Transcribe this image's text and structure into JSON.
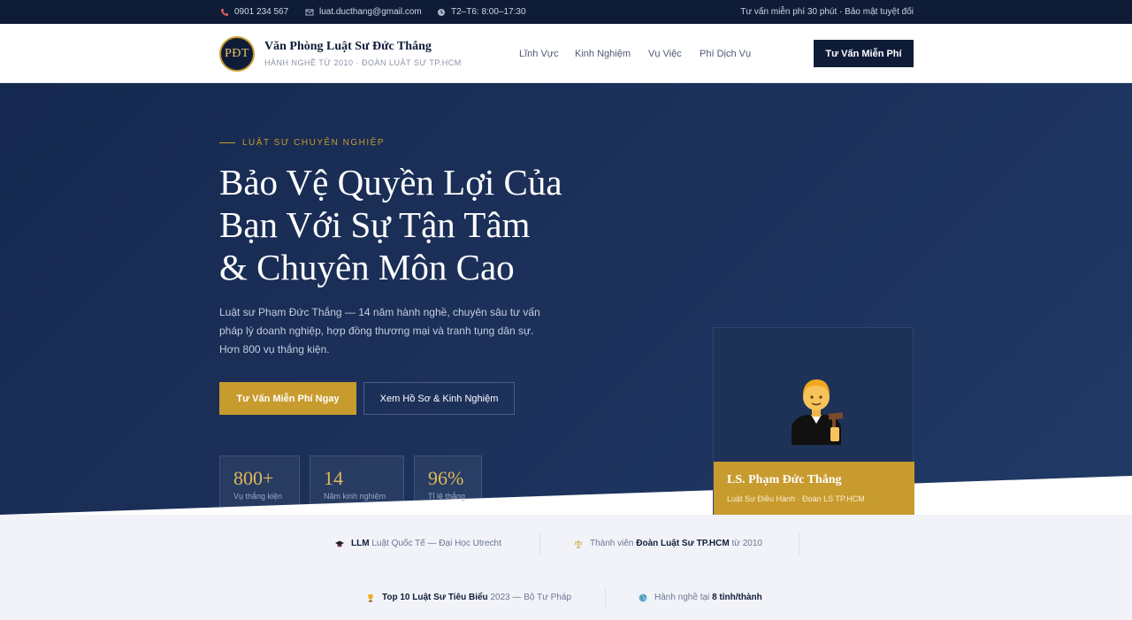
{
  "topbar": {
    "phone": "0901 234 567",
    "email": "luat.ducthang@gmail.com",
    "hours": "T2–T6: 8:00–17:30",
    "promo": "Tư vấn miễn phí 30 phút · Bảo mật tuyệt đối"
  },
  "header": {
    "logo_text": "PĐT",
    "brand_name": "Văn Phòng Luật Sư Đức Thắng",
    "brand_sub": "HÀNH NGHỀ TỪ 2010 · ĐOÀN LUẬT SƯ TP.HCM",
    "nav": [
      "Lĩnh Vực",
      "Kinh Nghiệm",
      "Vụ Việc",
      "Phí Dịch Vụ"
    ],
    "cta": "Tư Vấn Miễn Phí"
  },
  "hero": {
    "eyebrow": "LUẬT SƯ CHUYÊN NGHIỆP",
    "title_line1": "Bảo Vệ Quyền Lợi Của",
    "title_line2": "Bạn Với Sự Tận Tâm",
    "title_line3": "& Chuyên Môn Cao",
    "lead": "Luật sư Phạm Đức Thắng — 14 năm hành nghề, chuyên sâu tư vấn pháp lý doanh nghiệp, hợp đồng thương mại và tranh tụng dân sự. Hơn 800 vụ thắng kiện.",
    "primary_button": "Tư Vấn Miễn Phí Ngay",
    "secondary_button": "Xem Hồ Sơ & Kinh Nghiệm",
    "stats": [
      {
        "value": "800+",
        "label": "Vụ thắng kiện"
      },
      {
        "value": "14",
        "label": "Năm kinh nghiệm"
      },
      {
        "value": "96%",
        "label": "Tỉ lệ thắng"
      }
    ],
    "profile": {
      "name": "LS. Phạm Đức Thắng",
      "role": "Luật Sư Điều Hành · Đoàn LS TP.HCM"
    }
  },
  "credentials": [
    {
      "icon": "graduation-cap-icon",
      "bold": "LLM",
      "text": "Luật Quốc Tế — Đại Học Utrecht"
    },
    {
      "icon": "scales-icon",
      "pre": "Thành viên",
      "bold": "Đoàn Luật Sư TP.HCM",
      "text": "từ 2010"
    },
    {
      "icon": "trophy-icon",
      "bold": "Top 10 Luật Sư Tiêu Biểu",
      "text": "2023 — Bộ Tư Pháp"
    },
    {
      "icon": "globe-icon",
      "pre": "Hành nghề tại",
      "bold": "8 tỉnh/thành"
    }
  ],
  "colors": {
    "navy": "#0f1c38",
    "gold": "#c89b2e",
    "hero_bg": "#1b2f58",
    "light_bg": "#f1f3f9"
  }
}
